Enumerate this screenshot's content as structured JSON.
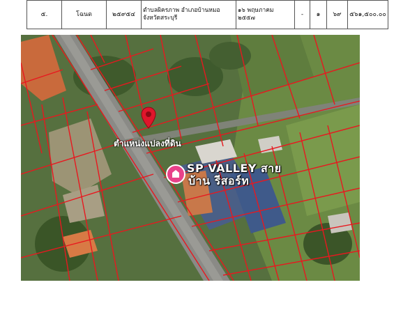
{
  "table_row": {
    "no": "๕.",
    "doc_type": "โฉนด",
    "doc_no": "๒๕๙๕๔",
    "location": "ตำบลผิครภาพ อำเภอบ้านหมอ จังหวัดสระบุรี",
    "date": "๑๖ พฤษภาคม ๒๕๕๗",
    "col6": "-",
    "col7": "๑",
    "col8": "๖๙",
    "price": "๕๖๑,๕๐๐.๐๐"
  },
  "map": {
    "pin_label": "ตำแหน่งแปลงที่ดิน",
    "place_name_line1": "SP VALLEY สาย",
    "place_name_line2": "บ้าน รีสอร์ท",
    "pin_color": "#e0162b",
    "place_icon_color": "#e8428a",
    "parcel_line_color": "#e8181f"
  }
}
